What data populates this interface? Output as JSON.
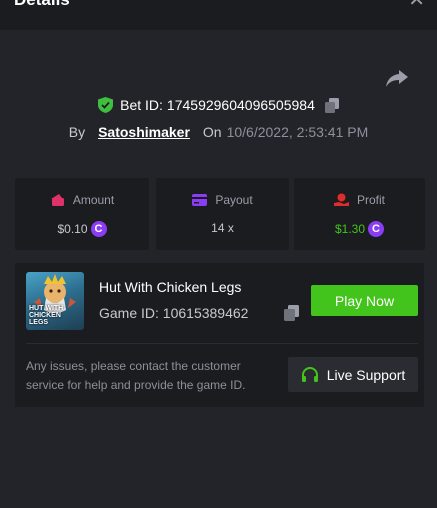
{
  "header": {
    "title": "Details"
  },
  "bet": {
    "id_label": "Bet ID:",
    "id_value": "1745929604096505984",
    "by_label": "By",
    "username": "Satoshimaker",
    "on_label": "On",
    "date": "10/6/2022, 2:53:41 PM"
  },
  "stats": {
    "amount": {
      "label": "Amount",
      "value": "$0.10",
      "color": "#e0316a"
    },
    "payout": {
      "label": "Payout",
      "value": "14 x",
      "color": "#8b3df5"
    },
    "profit": {
      "label": "Profit",
      "value": "$1.30",
      "value_color": "#42c41c",
      "color": "#e02c2c"
    }
  },
  "coin": {
    "symbol": "C",
    "color": "#8b3df5"
  },
  "game": {
    "thumb_text": "HUT WITH CHICKEN LEGS",
    "name": "Hut With Chicken Legs",
    "id_label": "Game ID:",
    "id_value": "10615389462",
    "play_label": "Play Now"
  },
  "support": {
    "text": "Any issues, please contact the customer service for help and provide the game ID.",
    "button_label": "Live Support"
  },
  "colors": {
    "background": "#232429",
    "card": "#1b1c20",
    "accent_green": "#42c41c",
    "shield_green": "#3fbf3f"
  },
  "icons": [
    "close-icon",
    "share-icon",
    "shield-check-icon",
    "copy-icon",
    "wallet-icon",
    "card-icon",
    "profit-icon",
    "coin-icon",
    "headset-icon"
  ]
}
